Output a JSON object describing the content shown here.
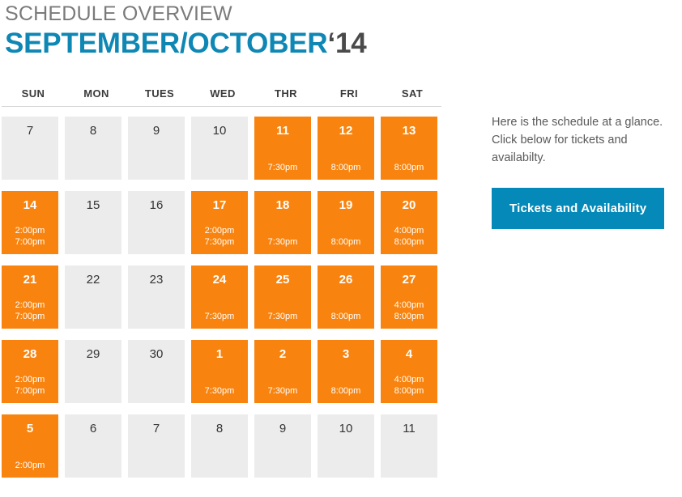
{
  "header": {
    "overview_label": "SCHEDULE OVERVIEW",
    "months": "SEPTEMBER/OCTOBER",
    "year": "‘14"
  },
  "colors": {
    "accent_blue": "#0f87b4",
    "button_blue": "#0589b8",
    "active_orange": "#f8840f",
    "inactive_gray": "#ececec",
    "header_gray": "#7a7a7a"
  },
  "calendar": {
    "day_headers": [
      "SUN",
      "MON",
      "TUES",
      "WED",
      "THR",
      "FRI",
      "SAT"
    ],
    "weeks": [
      [
        {
          "date": "7",
          "active": false,
          "times": []
        },
        {
          "date": "8",
          "active": false,
          "times": []
        },
        {
          "date": "9",
          "active": false,
          "times": []
        },
        {
          "date": "10",
          "active": false,
          "times": []
        },
        {
          "date": "11",
          "active": true,
          "times": [
            "7:30pm"
          ]
        },
        {
          "date": "12",
          "active": true,
          "times": [
            "8:00pm"
          ]
        },
        {
          "date": "13",
          "active": true,
          "times": [
            "8:00pm"
          ]
        }
      ],
      [
        {
          "date": "14",
          "active": true,
          "times": [
            "2:00pm",
            "7:00pm"
          ]
        },
        {
          "date": "15",
          "active": false,
          "times": []
        },
        {
          "date": "16",
          "active": false,
          "times": []
        },
        {
          "date": "17",
          "active": true,
          "times": [
            "2:00pm",
            "7:30pm"
          ]
        },
        {
          "date": "18",
          "active": true,
          "times": [
            "7:30pm"
          ]
        },
        {
          "date": "19",
          "active": true,
          "times": [
            "8:00pm"
          ]
        },
        {
          "date": "20",
          "active": true,
          "times": [
            "4:00pm",
            "8:00pm"
          ]
        }
      ],
      [
        {
          "date": "21",
          "active": true,
          "times": [
            "2:00pm",
            "7:00pm"
          ]
        },
        {
          "date": "22",
          "active": false,
          "times": []
        },
        {
          "date": "23",
          "active": false,
          "times": []
        },
        {
          "date": "24",
          "active": true,
          "times": [
            "7:30pm"
          ]
        },
        {
          "date": "25",
          "active": true,
          "times": [
            "7:30pm"
          ]
        },
        {
          "date": "26",
          "active": true,
          "times": [
            "8:00pm"
          ]
        },
        {
          "date": "27",
          "active": true,
          "times": [
            "4:00pm",
            "8:00pm"
          ]
        }
      ],
      [
        {
          "date": "28",
          "active": true,
          "times": [
            "2:00pm",
            "7:00pm"
          ]
        },
        {
          "date": "29",
          "active": false,
          "times": []
        },
        {
          "date": "30",
          "active": false,
          "times": []
        },
        {
          "date": "1",
          "active": true,
          "times": [
            "7:30pm"
          ]
        },
        {
          "date": "2",
          "active": true,
          "times": [
            "7:30pm"
          ]
        },
        {
          "date": "3",
          "active": true,
          "times": [
            "8:00pm"
          ]
        },
        {
          "date": "4",
          "active": true,
          "times": [
            "4:00pm",
            "8:00pm"
          ]
        }
      ],
      [
        {
          "date": "5",
          "active": true,
          "times": [
            "2:00pm"
          ]
        },
        {
          "date": "6",
          "active": false,
          "times": []
        },
        {
          "date": "7",
          "active": false,
          "times": []
        },
        {
          "date": "8",
          "active": false,
          "times": []
        },
        {
          "date": "9",
          "active": false,
          "times": []
        },
        {
          "date": "10",
          "active": false,
          "times": []
        },
        {
          "date": "11",
          "active": false,
          "times": []
        }
      ]
    ]
  },
  "sidebar": {
    "description": "Here is the schedule at a glance. Click below for tickets and availabilty.",
    "button_label": "Tickets and Availability"
  }
}
